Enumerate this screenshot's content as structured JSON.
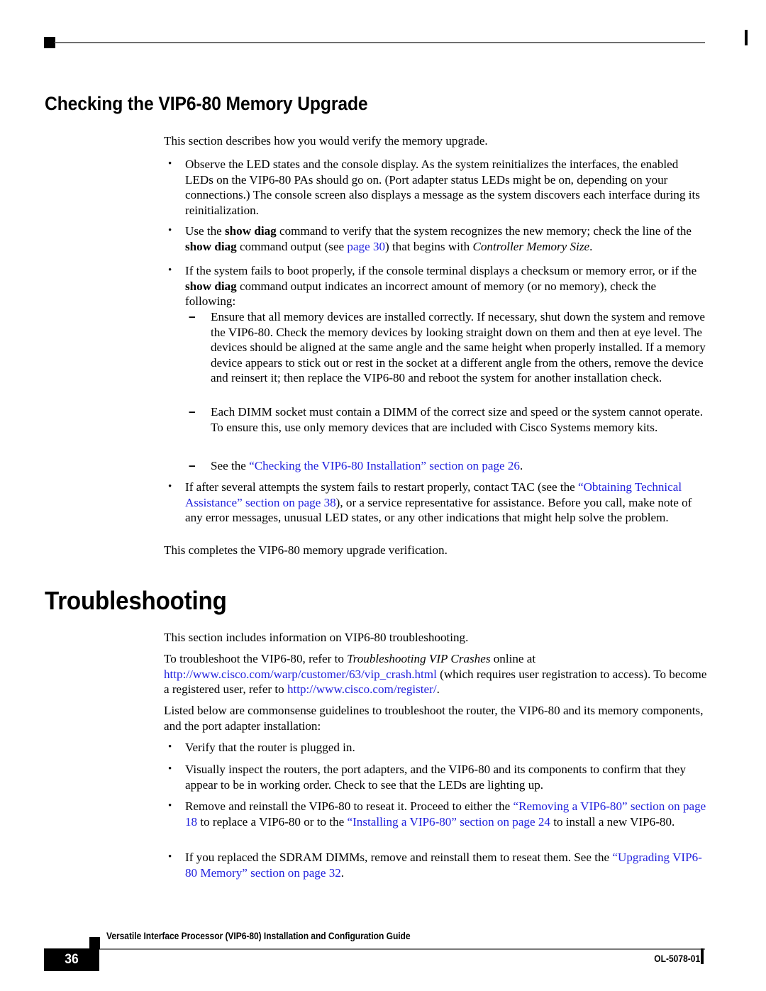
{
  "document": {
    "section_heading": "Checking the VIP6-80 Memory Upgrade",
    "chapter_heading": "Troubleshooting"
  },
  "content": {
    "intro": "This section describes how you would verify the memory upgrade.",
    "bullet1": "Observe the LED states and the console display. As the system reinitializes the interfaces, the enabled LEDs on the VIP6-80 PAs should go on. (Port adapter status LEDs might be on, depending on your connections.) The console screen also displays a message as the system discovers each interface during its reinitialization.",
    "bullet2": {
      "part1": "Use the ",
      "cmd1": "show diag",
      "part2": " command to verify that the system recognizes the new memory; check the line of the ",
      "cmd2": "show diag",
      "part3": " command output (see ",
      "link": "page 30",
      "part4": ") that begins with ",
      "italic": "Controller Memory Size",
      "part5": "."
    },
    "bullet3": {
      "part1": "If the system fails to boot properly, if the console terminal displays a checksum or memory error, or if the ",
      "cmd1": "show diag",
      "part2": " command output indicates an incorrect amount of memory (or no memory), check the following:"
    },
    "dash1": "Ensure that all memory devices are installed correctly. If necessary, shut down the system and remove the VIP6-80. Check the memory devices by looking straight down on them and then at eye level. The devices should be aligned at the same angle and the same height when properly installed. If a memory device appears to stick out or rest in the socket at a different angle from the others, remove the device and reinsert it; then replace the VIP6-80 and reboot the system for another installation check.",
    "dash2": "Each DIMM socket must contain a DIMM of the correct size and speed or the system cannot operate. To ensure this, use only memory devices that are included with Cisco Systems memory kits.",
    "dash3": {
      "part1": "See the ",
      "link": "“Checking the VIP6-80 Installation” section on page 26",
      "part2": "."
    },
    "bullet4": {
      "part1": "If after several attempts the system fails to restart properly, contact TAC (see the ",
      "link": "“Obtaining Technical Assistance” section on page 38",
      "part2": "), or a service representative for assistance. Before you call, make note of any error messages, unusual LED states, or any other indications that might help solve the problem."
    },
    "closing": "This completes the VIP6-80 memory upgrade verification.",
    "ts_intro": "This section includes information on VIP6-80 troubleshooting.",
    "ts_para2": {
      "part1": "To troubleshoot the VIP6-80, refer to ",
      "italic": "Troubleshooting VIP Crashes",
      "part2": " online at ",
      "link1": "http://www.cisco.com/warp/customer/63/vip_crash.html",
      "part3": " (which requires user registration to access). To become a registered user, refer to ",
      "link2": "http://www.cisco.com/register/",
      "part4": "."
    },
    "ts_para3": "Listed below are commonsense guidelines to troubleshoot the router, the VIP6-80 and its memory components, and the port adapter installation:",
    "ts_bullet1": "Verify that the router is plugged in.",
    "ts_bullet2": "Visually inspect the routers, the port adapters, and the VIP6-80 and its components to confirm that they appear to be in working order. Check to see that the LEDs are lighting up.",
    "ts_bullet3": {
      "part1": "Remove and reinstall the VIP6-80 to reseat it. Proceed to either the ",
      "link1": "“Removing a VIP6-80” section on page 18",
      "part2": " to replace a VIP6-80 or to the ",
      "link2": "“Installing a VIP6-80” section on page 24",
      "part3": " to install a new VIP6-80."
    },
    "ts_bullet4": {
      "part1": "If you replaced the SDRAM DIMMs, remove and reinstall them to reseat them. See the ",
      "link": "“Upgrading VIP6-80 Memory” section on page 32",
      "part2": "."
    },
    "bullet_marker": "•",
    "dash_marker": "–"
  },
  "footer": {
    "page_number": "36",
    "title": "Versatile Interface Processor (VIP6-80) Installation and Configuration Guide",
    "doc_id": "OL-5078-01"
  },
  "colors": {
    "link": "#2121dd",
    "rule": "#7a7a7a",
    "text": "#000000"
  }
}
